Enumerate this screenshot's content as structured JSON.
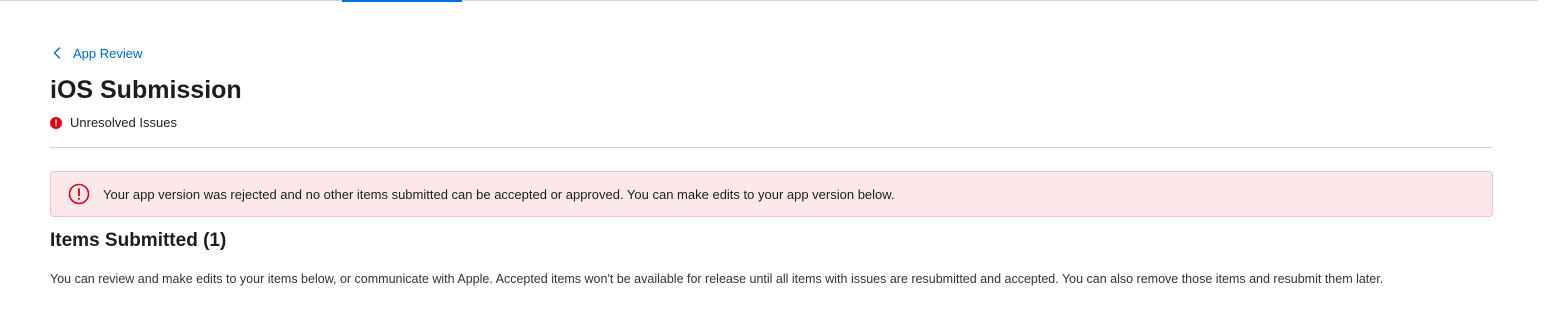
{
  "breadcrumb": {
    "label": "App Review",
    "icon": "chevron-left-icon"
  },
  "page": {
    "title": "iOS Submission",
    "status": {
      "icon": "error-icon",
      "icon_glyph": "!",
      "label": "Unresolved Issues",
      "color": "#d70015"
    }
  },
  "alert": {
    "icon": "alert-circle-icon",
    "text": "Your app version was rejected and no other items submitted can be accepted or approved. You can make edits to your app version below.",
    "background": "#fce8ea",
    "accent": "#d70015"
  },
  "items_section": {
    "title": "Items Submitted (1)",
    "description": "You can review and make edits to your items below, or communicate with Apple. Accepted items won't be available for release until all items with issues are resubmitted and accepted. You can also remove those items and resubmit them later."
  },
  "colors": {
    "link": "#0066cc",
    "tab_indicator": "#0071e3",
    "divider": "#d2d2d7"
  }
}
